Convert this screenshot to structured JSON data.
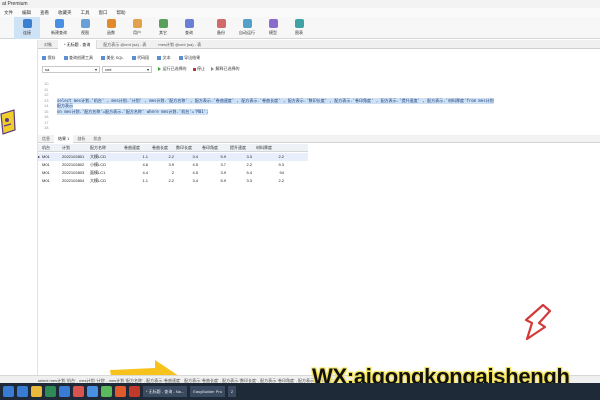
{
  "window": {
    "title": "at Premium"
  },
  "menu": [
    "文件",
    "编辑",
    "查看",
    "收藏夹",
    "工具",
    "窗口",
    "帮助"
  ],
  "ribbon": [
    {
      "label": "连接",
      "color": "#3b7fd0",
      "active": true
    },
    {
      "label": "新建查询",
      "color": "#4a90e2",
      "active": false
    },
    {
      "label": "视图",
      "color": "#6aa0d8",
      "active": false
    },
    {
      "label": "函数",
      "color": "#e08a2c",
      "active": false
    },
    {
      "label": "用户",
      "color": "#e0a24a",
      "active": false
    },
    {
      "label": "其它",
      "color": "#5a9f5a",
      "active": false
    },
    {
      "label": "查询",
      "color": "#6c7fd6",
      "active": false
    },
    {
      "label": "备份",
      "color": "#d06a6a",
      "active": false
    },
    {
      "label": "自动运行",
      "color": "#55a0c8",
      "active": false
    },
    {
      "label": "模型",
      "color": "#8a6ccf",
      "active": false
    },
    {
      "label": "图表",
      "color": "#3fa3a3",
      "active": false
    }
  ],
  "tabs": [
    {
      "label": "对象",
      "active": false
    },
    {
      "label": "* 无标题 - 查询",
      "active": true
    },
    {
      "label": "配方表示 @cmt (sa) - 表",
      "active": false
    },
    {
      "label": "mes计划 @cmt (sa) - 表",
      "active": false
    }
  ],
  "toolbar": [
    "保存",
    "查询创建工具",
    "美化 SQL",
    "代码段",
    "文本",
    "导出结果"
  ],
  "connection": {
    "server": "sa",
    "database": "cmt",
    "run_selected": "运行已选择的",
    "stop": "停止",
    "explain": "解释已选择的"
  },
  "editor": {
    "line_numbers": [
      "10",
      "11",
      "12",
      "13",
      "14",
      "15",
      "16",
      "17",
      "18"
    ],
    "line1": "select mes计划.'机台' , mes计划.'计划' , mes计划.'配方名称' , 配方表示.'卷曲速度' , 配方表示.'卷曲长度' , 配方表示.'数印长度' , 配方表示.'卷印角度' , 配方表示.'提升速度' , 配方表示.'材料厚度'from mes计划",
    "line2": "配方表示",
    "line3": "on mes计划.'配方名称'=配方表示.'配方名称'  where mes计划.'机台'='M01';"
  },
  "result_tabs": [
    "信息",
    "结果 1",
    "剖析",
    "状态"
  ],
  "result_tab_active": 1,
  "grid": {
    "headers": [
      "机台",
      "计划",
      "配方名称",
      "卷曲速度",
      "卷曲长度",
      "数印长度",
      "卷印角度",
      "提升速度",
      "材料厚度"
    ],
    "rows": [
      [
        "M01",
        "2022102801",
        "大模LCD",
        "1.1",
        "2.2",
        "3.4",
        "5.9",
        "3.3",
        "2.2"
      ],
      [
        "M01",
        "2022102802",
        "小模LCD",
        "4.6",
        "3.9",
        "4.5",
        "3.7",
        "2.2",
        "9.3"
      ],
      [
        "M01",
        "2022102803",
        "面模LC1",
        "4.4",
        "2",
        "4.5",
        "3.9",
        "5.4",
        "94"
      ],
      [
        "M01",
        "2022102804",
        "大模LCD",
        "1.1",
        "2.2",
        "3.4",
        "5.9",
        "3.3",
        "2.2"
      ]
    ]
  },
  "status": {
    "text": "select mes计划.'机台' , mes计划.'计划' , mes计划.'配方名称' , 配方表示.'卷曲速度' , 配方表示.'卷曲长度' , 配方表示.'数印长度' , 配方表示.'卷印角度' , 配方表示.'提升速度'"
  },
  "watermark": "WX:aigongkongaishengh",
  "taskbar": {
    "apps": [
      "#3a7bd5",
      "#3a7bd5",
      "#e8b93b",
      "#2e8b57",
      "#3a7bd5",
      "#d9534f",
      "#4a90e2",
      "#5cb85c",
      "#e05a2b",
      "#c0392b"
    ],
    "windows": [
      "* 无标题 - 查询 - Na...",
      "EasyBuilder Pro",
      "2"
    ]
  }
}
